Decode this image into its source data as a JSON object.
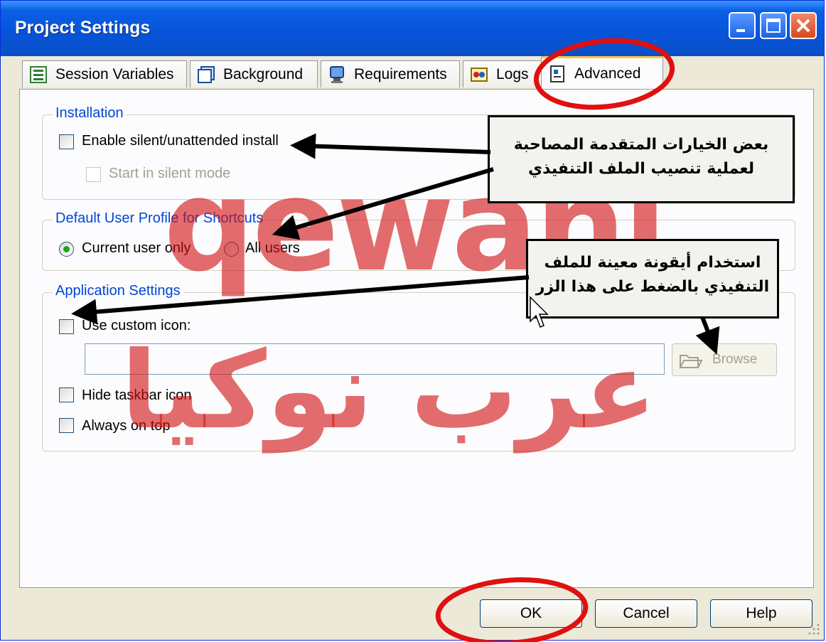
{
  "window": {
    "title": "Project Settings"
  },
  "tabs": [
    {
      "label": "Session Variables"
    },
    {
      "label": "Background"
    },
    {
      "label": "Requirements"
    },
    {
      "label": "Logs"
    },
    {
      "label": "Advanced"
    }
  ],
  "installation": {
    "legend": "Installation",
    "enable_silent": {
      "label": "Enable silent/unattended install",
      "checked": false
    },
    "start_silent": {
      "label": "Start in silent mode",
      "checked": false,
      "enabled": false
    }
  },
  "profile": {
    "legend": "Default User Profile for Shortcuts",
    "options": [
      {
        "label": "Current user only",
        "selected": true
      },
      {
        "label": "All users",
        "selected": false
      }
    ]
  },
  "app_settings": {
    "legend": "Application Settings",
    "custom_icon": {
      "label": "Use custom icon:",
      "checked": false
    },
    "icon_path": {
      "value": ""
    },
    "browse_label": "Browse",
    "hide_taskbar": {
      "label": "Hide taskbar icon",
      "checked": false
    },
    "always_on_top": {
      "label": "Always on top",
      "checked": false
    }
  },
  "buttons": {
    "ok": "OK",
    "cancel": "Cancel",
    "help": "Help"
  },
  "annotations": {
    "callout1": "بعض الخيارات المتقدمة المصاحبة لعملية تنصيب الملف التنفيذي",
    "callout2": "استخدام أيقونة معينة للملف التنفيذي بالضغط على هذا الزر",
    "watermark_latin": "qewani",
    "watermark_arabic": "عرب نوكيا"
  },
  "colors": {
    "titlebar": "#0753d8",
    "legend_text": "#0046d5",
    "watermark": "#d21414",
    "highlight_circle": "#e01010",
    "active_tab_accent": "#ffc83c"
  }
}
